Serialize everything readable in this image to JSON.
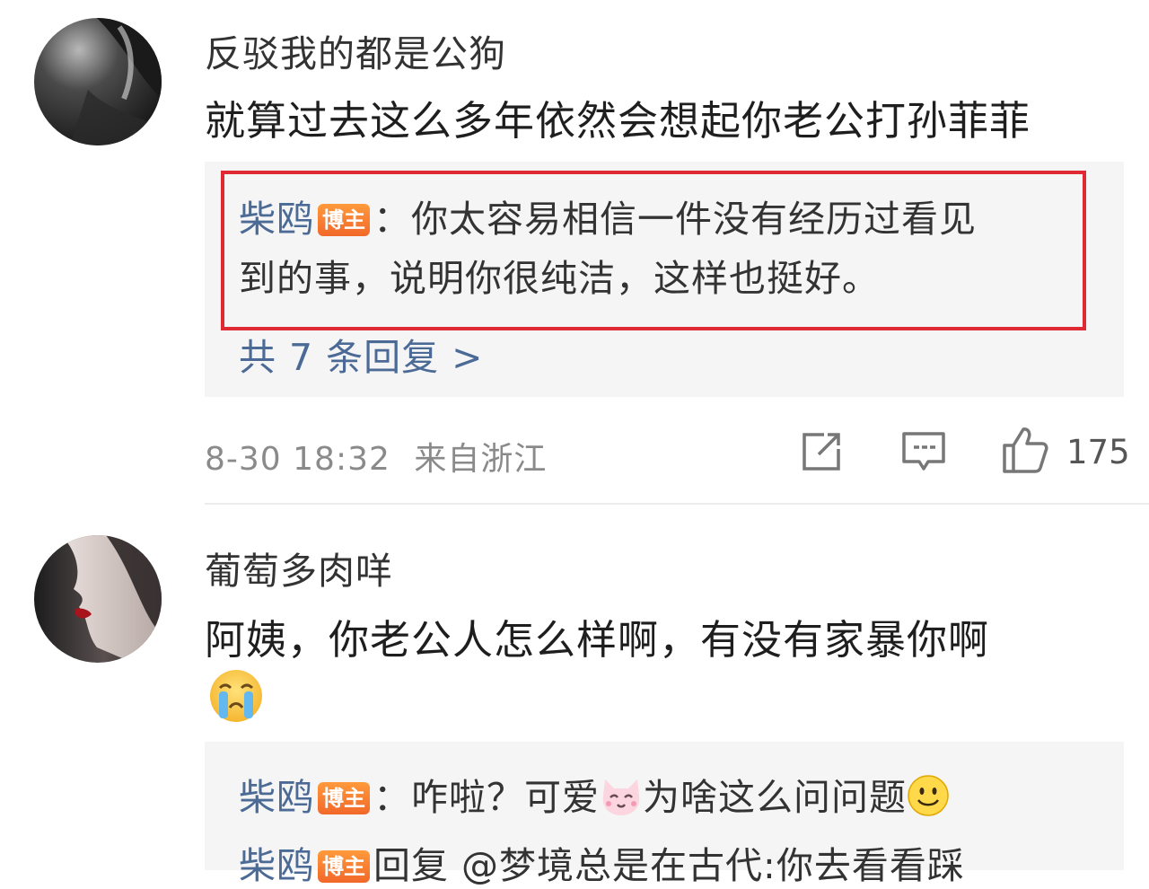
{
  "comments": [
    {
      "username": "反驳我的都是公狗",
      "text": "就算过去这么多年依然会想起你老公打孙菲菲",
      "reply": {
        "author": "柴鸥",
        "badge": "博主",
        "line1": "：你太容易相信一件没有经历过看见",
        "line2": "到的事，说明你很纯洁，这样也挺好。"
      },
      "more_replies": "共 7 条回复 >",
      "timestamp": "8-30 18:32",
      "location": "来自浙江",
      "likes": "175",
      "icons": [
        "share-icon",
        "comment-icon",
        "like-icon"
      ]
    },
    {
      "username": "葡萄多肉咩",
      "text": "阿姨，你老公人怎么样啊，有没有家暴你啊",
      "emoji": "crying-emoji",
      "reply": {
        "author": "柴鸥",
        "badge": "博主",
        "line1_a": "：咋啦？可爱",
        "line1_b": "为啥这么问问题"
      },
      "reply2": {
        "author": "柴鸥",
        "badge": "博主",
        "text": "回复 @梦境总是在古代:你去看看踩"
      }
    }
  ],
  "colors": {
    "highlight": "#e02a33",
    "link": "#4b6a96",
    "badge": "#f2682a",
    "reply_bg": "#f5f5f5"
  }
}
